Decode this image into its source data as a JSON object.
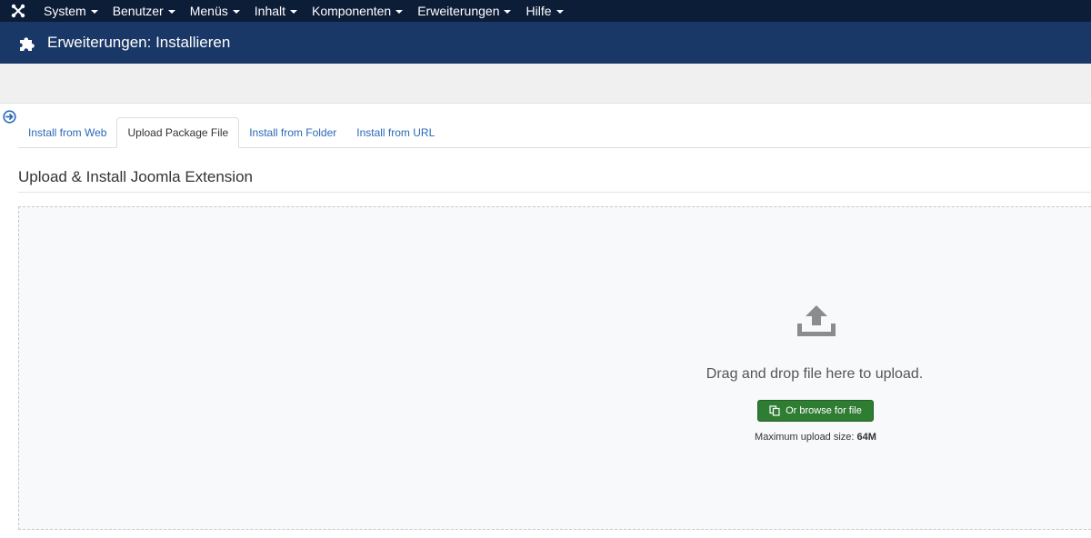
{
  "menu": {
    "logo_icon": "joomla-logo-icon",
    "items": [
      {
        "label": "System"
      },
      {
        "label": "Benutzer"
      },
      {
        "label": "Menüs"
      },
      {
        "label": "Inhalt"
      },
      {
        "label": "Komponenten"
      },
      {
        "label": "Erweiterungen"
      },
      {
        "label": "Hilfe"
      }
    ]
  },
  "header": {
    "icon": "puzzle-icon",
    "title": "Erweiterungen: Installieren"
  },
  "sidebar": {
    "toggle_icon": "arrow-right-circle-icon"
  },
  "tabs": [
    {
      "label": "Install from Web",
      "active": false
    },
    {
      "label": "Upload Package File",
      "active": true
    },
    {
      "label": "Install from Folder",
      "active": false
    },
    {
      "label": "Install from URL",
      "active": false
    }
  ],
  "section": {
    "title": "Upload & Install Joomla Extension"
  },
  "upload": {
    "icon": "upload-icon",
    "drop_text": "Drag and drop file here to upload.",
    "browse_label": "Or browse for file",
    "browse_icon": "copy-icon",
    "max_label": "Maximum upload size:",
    "max_value": "64M"
  },
  "colors": {
    "topbar": "#0c1d38",
    "header": "#1a3867",
    "tab_link": "#2a69b8",
    "button": "#2f7d32"
  }
}
